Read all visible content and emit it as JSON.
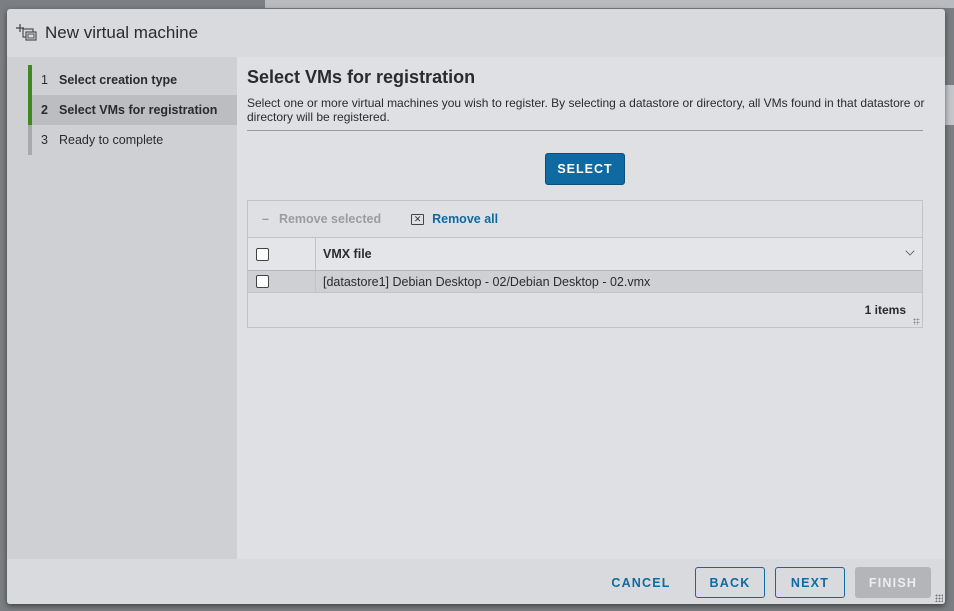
{
  "dialog": {
    "title": "New virtual machine",
    "icon": "new-vm-icon"
  },
  "steps": [
    {
      "num": "1",
      "label": "Select creation type",
      "state": "completed"
    },
    {
      "num": "2",
      "label": "Select VMs for registration",
      "state": "current"
    },
    {
      "num": "3",
      "label": "Ready to complete",
      "state": "pending"
    }
  ],
  "content": {
    "heading": "Select VMs for registration",
    "description": "Select one or more virtual machines you wish to register. By selecting a datastore or directory, all VMs found in that datastore or directory will be registered.",
    "select_label": "SELECT"
  },
  "grid": {
    "toolbar": {
      "remove_selected": "Remove selected",
      "remove_all": "Remove all"
    },
    "columns": [
      "VMX file"
    ],
    "rows": [
      {
        "vmx": "[datastore1] Debian Desktop - 02/Debian Desktop - 02.vmx"
      }
    ],
    "count_label": "1 items"
  },
  "footer": {
    "cancel": "CANCEL",
    "back": "BACK",
    "next": "NEXT",
    "finish": "FINISH"
  },
  "colors": {
    "accent": "#0e6aa1",
    "step_done": "#3c8a1f",
    "step_pending": "#a8a9ad"
  }
}
